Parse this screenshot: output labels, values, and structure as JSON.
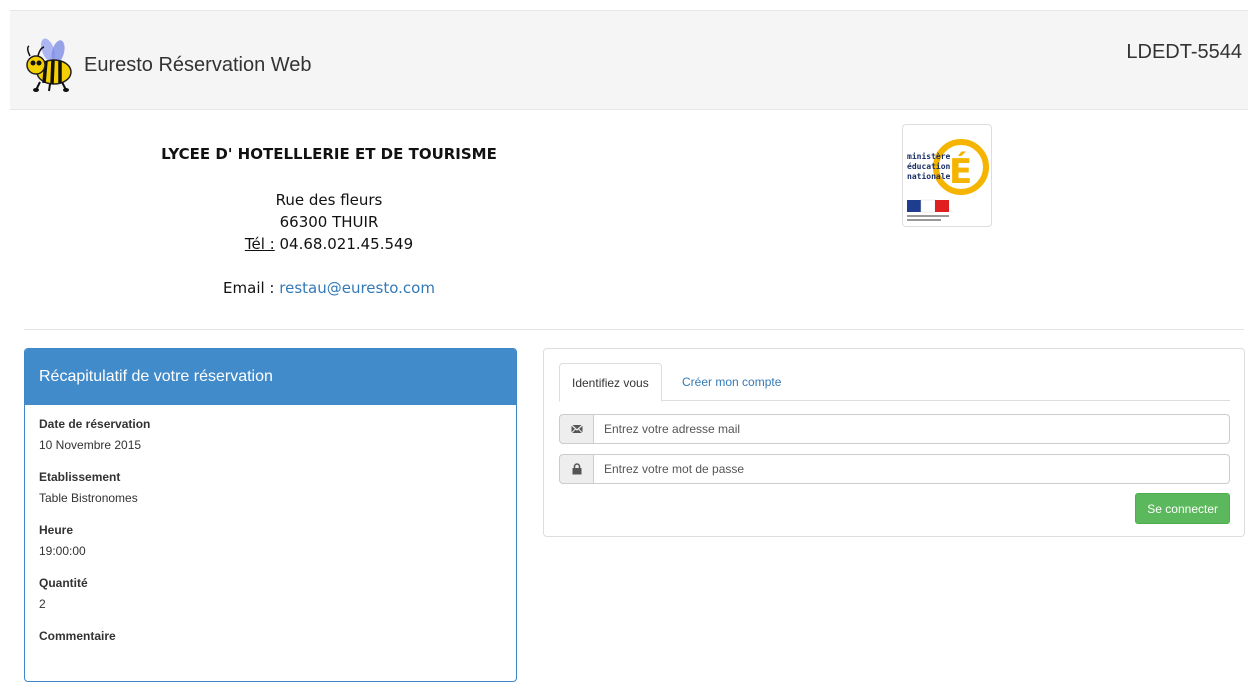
{
  "header": {
    "app_title": "Euresto Réservation Web",
    "code": "LDEDT-5544"
  },
  "school": {
    "name": "LYCEE D' HOTELLLERIE ET DE TOURISME",
    "street": "Rue des fleurs",
    "city": "66300 THUIR",
    "tel_label": "Tél :",
    "tel_value": "04.68.021.45.549",
    "email_label": "Email :",
    "email_value": "restau@euresto.com",
    "logo": {
      "lines": [
        "ministère",
        "éducation",
        "nationale"
      ],
      "letter": "É"
    }
  },
  "summary": {
    "title": "Récapitulatif de votre réservation",
    "fields": [
      {
        "label": "Date de réservation",
        "value": "10 Novembre 2015"
      },
      {
        "label": "Etablissement",
        "value": "Table Bistronomes"
      },
      {
        "label": "Heure",
        "value": "19:00:00"
      },
      {
        "label": "Quantité",
        "value": "2"
      },
      {
        "label": "Commentaire",
        "value": ""
      }
    ]
  },
  "login": {
    "tabs": [
      {
        "label": "Identifiez vous",
        "active": true
      },
      {
        "label": "Créer mon compte",
        "active": false
      }
    ],
    "email_placeholder": "Entrez votre adresse mail",
    "password_placeholder": "Entrez votre mot de passe",
    "submit_label": "Se connecter",
    "icons": {
      "email": "envelope-icon",
      "password": "lock-icon"
    }
  },
  "colors": {
    "primary": "#428bca",
    "success": "#5cb85c",
    "link": "#337ab7",
    "logo_yellow": "#f5b400"
  }
}
